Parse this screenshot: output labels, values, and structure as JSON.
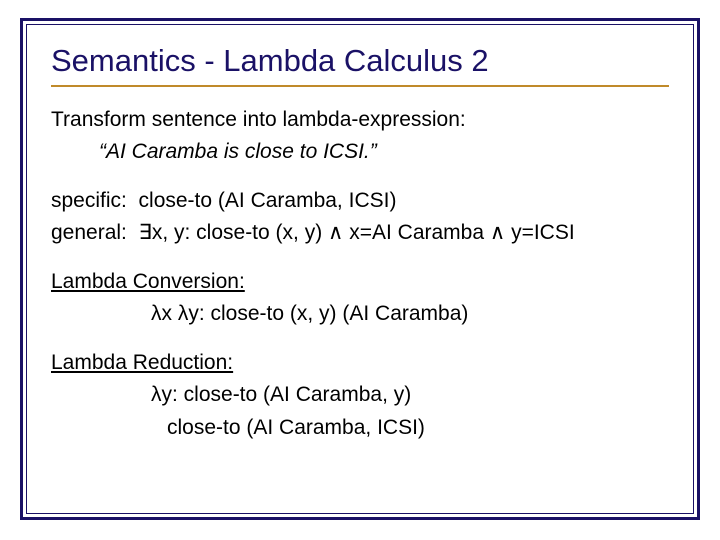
{
  "title": "Semantics - Lambda Calculus 2",
  "intro": "Transform sentence into lambda-expression:",
  "example": "“AI Caramba is close to ICSI.”",
  "specific_label": "specific:",
  "specific_value": "close-to (AI Caramba, ICSI)",
  "general_label": "general:",
  "general_value": "∃x, y: close-to (x, y) ∧ x=AI Caramba ∧ y=ICSI",
  "conversion_heading": "Lambda Conversion:",
  "conversion_line": "λx λy: close-to (x, y) (AI Caramba)",
  "reduction_heading": "Lambda Reduction:",
  "reduction_line1": "λy: close-to (AI Caramba, y)",
  "reduction_line2": "close-to (AI Caramba, ICSI)"
}
